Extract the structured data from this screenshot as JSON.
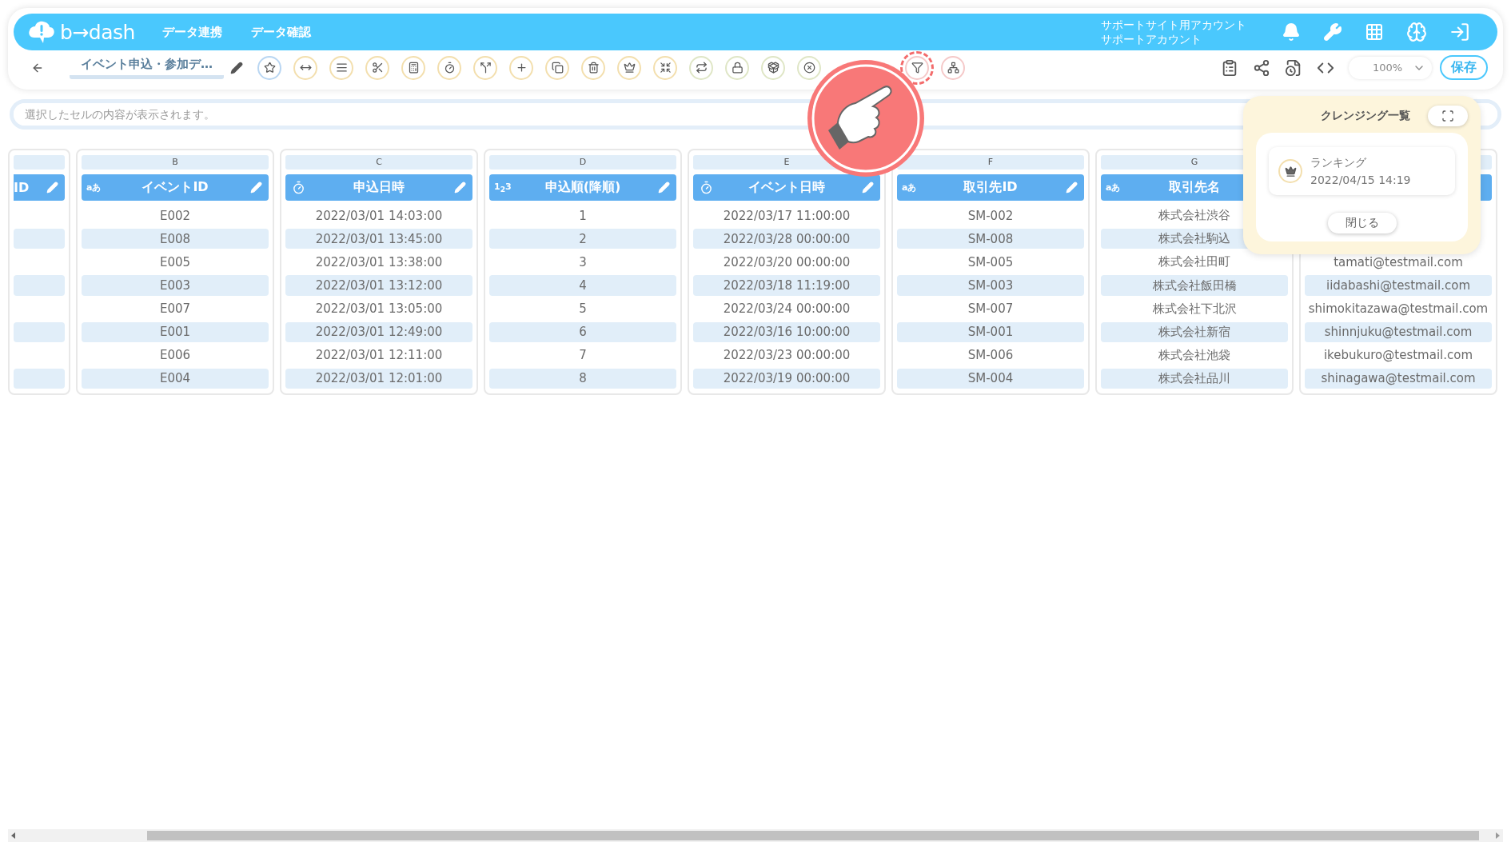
{
  "header": {
    "logo_text": "b→dash",
    "nav": [
      "データ連携",
      "データ確認"
    ],
    "account": [
      "サポートサイト用アカウント",
      "サポートアカウント"
    ]
  },
  "toolbar": {
    "title": "イベント申込・参加デ…",
    "tools": [
      {
        "kind": "star",
        "highlighted": false
      },
      {
        "kind": "stretch",
        "highlighted": false
      },
      {
        "kind": "lines",
        "highlighted": false
      },
      {
        "kind": "scissors",
        "highlighted": false
      },
      {
        "kind": "calc",
        "highlighted": false
      },
      {
        "kind": "timer",
        "highlighted": false
      },
      {
        "kind": "split",
        "highlighted": false
      },
      {
        "kind": "plus",
        "highlighted": false
      },
      {
        "kind": "copy",
        "highlighted": false
      },
      {
        "kind": "trash",
        "highlighted": false
      },
      {
        "kind": "crown",
        "highlighted": false
      },
      {
        "kind": "shrink",
        "highlighted": false
      },
      {
        "kind": "repeat",
        "highlighted": false
      },
      {
        "kind": "lock",
        "highlighted": false
      },
      {
        "kind": "package",
        "highlighted": false
      },
      {
        "kind": "cancel",
        "highlighted": false
      },
      {
        "kind": "covered"
      },
      {
        "kind": "covered"
      },
      {
        "kind": "filter",
        "highlighted": true
      },
      {
        "kind": "network",
        "highlighted": false
      }
    ],
    "zoom": "100%",
    "save": "保存"
  },
  "cell_bar": {
    "placeholder": "選択したセルの内容が表示されます。"
  },
  "columns": [
    {
      "name": "ID",
      "kind": "cut"
    },
    {
      "letter": "B",
      "name": "イベントID",
      "kind": "text",
      "badge": "aあ",
      "rows": [
        "E002",
        "E008",
        "E005",
        "E003",
        "E007",
        "E001",
        "E006",
        "E004"
      ]
    },
    {
      "letter": "C",
      "name": "申込日時",
      "kind": "datetime",
      "rows": [
        "2022/03/01 14:03:00",
        "2022/03/01 13:45:00",
        "2022/03/01 13:38:00",
        "2022/03/01 13:12:00",
        "2022/03/01 13:05:00",
        "2022/03/01 12:49:00",
        "2022/03/01 12:11:00",
        "2022/03/01 12:01:00"
      ]
    },
    {
      "letter": "D",
      "name": "申込順(降順)",
      "kind": "number",
      "badge": "1$_{2}$3",
      "rows": [
        "1",
        "2",
        "3",
        "4",
        "5",
        "6",
        "7",
        "8"
      ]
    },
    {
      "letter": "E",
      "name": "イベント日時",
      "kind": "datetime",
      "rows": [
        "2022/03/17 11:00:00",
        "2022/03/28 00:00:00",
        "2022/03/20 00:00:00",
        "2022/03/18 11:19:00",
        "2022/03/24 00:00:00",
        "2022/03/16 10:00:00",
        "2022/03/23 00:00:00",
        "2022/03/19 00:00:00"
      ]
    },
    {
      "letter": "F",
      "name": "取引先ID",
      "kind": "text",
      "badge": "aあ",
      "rows": [
        "SM-002",
        "SM-008",
        "SM-005",
        "SM-003",
        "SM-007",
        "SM-001",
        "SM-006",
        "SM-004"
      ]
    },
    {
      "letter": "G",
      "name": "取引先名",
      "kind": "text",
      "badge": "aあ",
      "rows": [
        "株式会社渋谷",
        "株式会社駒込",
        "株式会社田町",
        "株式会社飯田橋",
        "株式会社下北沢",
        "株式会社新宿",
        "株式会社池袋",
        "株式会社品川"
      ]
    },
    {
      "kind": "covered",
      "rows": [
        "tamati@testmail.com",
        "iidabashi@testmail.com",
        "shimokitazawa@testmail.com",
        "shinnjuku@testmail.com",
        "ikebukuro@testmail.com",
        "shinagawa@testmail.com"
      ]
    }
  ],
  "popup": {
    "title": "クレンジング一覧",
    "items": [
      {
        "name": "ランキング",
        "date": "2022/04/15 14:19"
      }
    ],
    "close": "閉じる"
  }
}
